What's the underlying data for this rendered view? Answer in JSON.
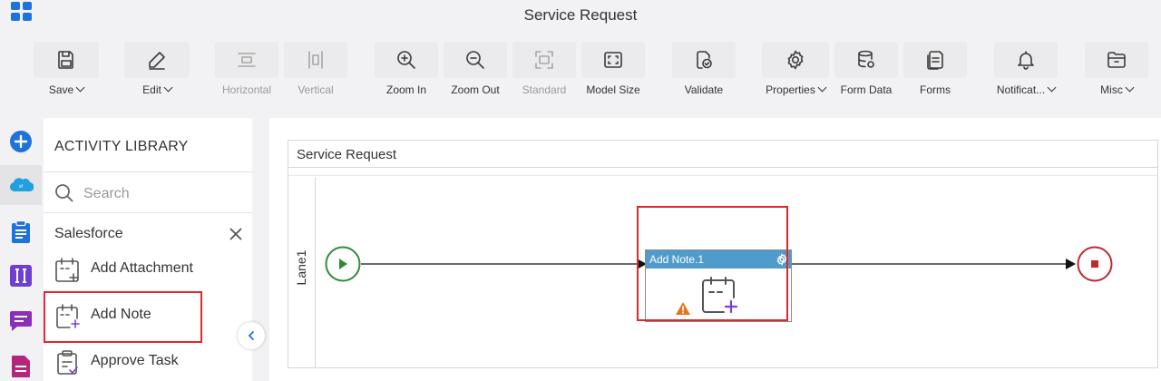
{
  "app": {
    "title": "Service Request"
  },
  "toolbar": {
    "items": [
      {
        "label": "Save",
        "icon": "save-icon",
        "dropdown": true,
        "enabled": true
      },
      {
        "label": "Edit",
        "icon": "pencil-icon",
        "dropdown": true,
        "enabled": true
      },
      {
        "label": "Horizontal",
        "icon": "horizontal-align-icon",
        "dropdown": false,
        "enabled": false
      },
      {
        "label": "Vertical",
        "icon": "vertical-align-icon",
        "dropdown": false,
        "enabled": false
      },
      {
        "label": "Zoom In",
        "icon": "zoom-in-icon",
        "dropdown": false,
        "enabled": true
      },
      {
        "label": "Zoom Out",
        "icon": "zoom-out-icon",
        "dropdown": false,
        "enabled": true
      },
      {
        "label": "Standard",
        "icon": "standard-view-icon",
        "dropdown": false,
        "enabled": false
      },
      {
        "label": "Model Size",
        "icon": "model-size-icon",
        "dropdown": false,
        "enabled": true
      },
      {
        "label": "Validate",
        "icon": "validate-icon",
        "dropdown": false,
        "enabled": true
      },
      {
        "label": "Properties",
        "icon": "gear-icon",
        "dropdown": true,
        "enabled": true
      },
      {
        "label": "Form Data",
        "icon": "database-icon",
        "dropdown": false,
        "enabled": true
      },
      {
        "label": "Forms",
        "icon": "forms-icon",
        "dropdown": false,
        "enabled": true
      },
      {
        "label": "Notificat...",
        "icon": "bell-icon",
        "dropdown": true,
        "enabled": true
      },
      {
        "label": "Misc",
        "icon": "folder-icon",
        "dropdown": true,
        "enabled": true
      }
    ]
  },
  "rail": {
    "items": [
      {
        "icon": "add-circle-icon"
      },
      {
        "icon": "salesforce-icon",
        "active": true
      },
      {
        "icon": "clipboard-icon"
      },
      {
        "icon": "bracket-icon"
      },
      {
        "icon": "chat-icon"
      },
      {
        "icon": "document-icon"
      }
    ]
  },
  "library": {
    "title": "ACTIVITY LIBRARY",
    "search_placeholder": "Search",
    "section": "Salesforce",
    "items": [
      {
        "label": "Add Attachment",
        "icon": "add-attachment-icon"
      },
      {
        "label": "Add Note",
        "icon": "add-note-icon",
        "highlighted": true
      },
      {
        "label": "Approve Task",
        "icon": "approve-task-icon"
      }
    ]
  },
  "canvas": {
    "pool_title": "Service Request",
    "lane_label": "Lane1",
    "task": {
      "name": "Add Note.1",
      "warning": true,
      "highlighted": true
    }
  },
  "colors": {
    "accent": "#1f73d8",
    "task_header": "#4f9ccc",
    "start_event": "#2e8b3a",
    "end_event": "#c0282e",
    "highlight": "#e0282e",
    "warning": "#e8731c"
  }
}
